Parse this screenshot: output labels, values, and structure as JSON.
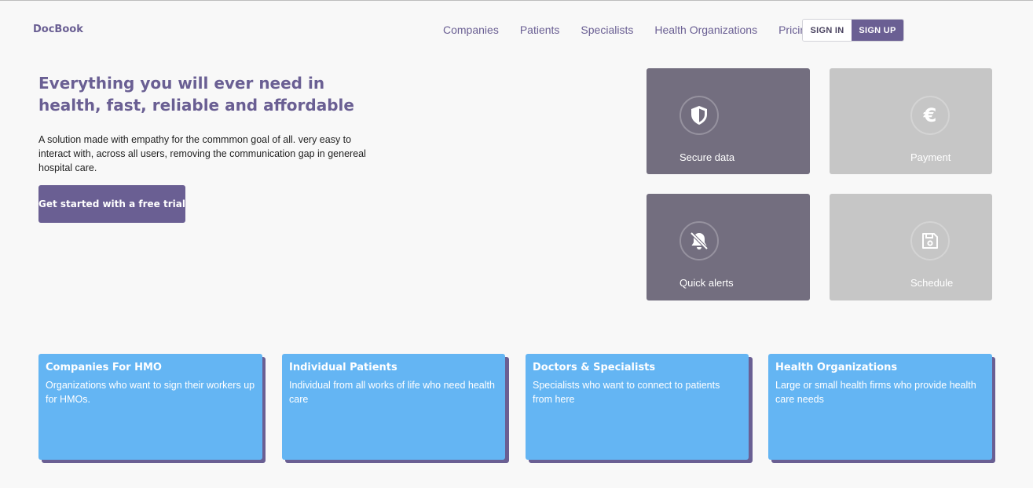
{
  "brand": "DocBook",
  "nav": {
    "links": [
      "Companies",
      "Patients",
      "Specialists",
      "Health Organizations",
      "Pricing"
    ],
    "sign_in": "SIGN IN",
    "sign_up": "SIGN UP"
  },
  "hero": {
    "title": "Everything you will ever need in health, fast, reliable and affordable",
    "description": "A solution made with empathy for the commmon goal of all. very easy to interact with, across all users, removing the communication gap in genereal hospital care.",
    "cta": "Get started with a free trial"
  },
  "features": [
    {
      "label": "Secure data",
      "icon": "shield-icon",
      "style": "dark"
    },
    {
      "label": "Payment",
      "icon": "euro-icon",
      "style": "light"
    },
    {
      "label": "Quick alerts",
      "icon": "bell-off-icon",
      "style": "dark"
    },
    {
      "label": "Schedule",
      "icon": "save-icon",
      "style": "light"
    }
  ],
  "cards": [
    {
      "title": "Companies For HMO",
      "description": "Organizations who want to sign their workers up for HMOs."
    },
    {
      "title": "Individual Patients",
      "description": "Individual from all works of life who need health care"
    },
    {
      "title": "Doctors & Specialists",
      "description": "Specialists who want to connect to patients from here"
    },
    {
      "title": "Health Organizations",
      "description": "Large or small health firms who provide health care needs"
    }
  ],
  "colors": {
    "brand": "#6a5f93",
    "tile_dark": "#736e7f",
    "tile_light": "#c6c6c6",
    "card": "#64b5f3"
  }
}
